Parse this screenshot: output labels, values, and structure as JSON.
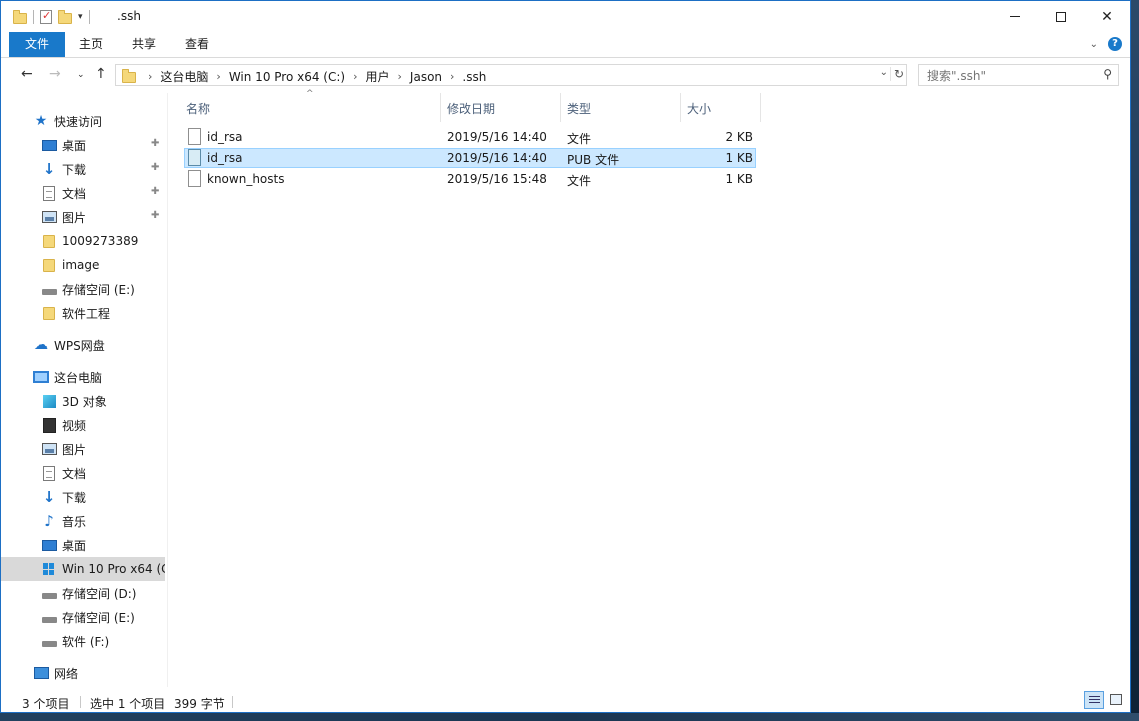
{
  "window": {
    "title": ".ssh"
  },
  "ribbon": {
    "tabs": [
      "文件",
      "主页",
      "共享",
      "查看"
    ]
  },
  "address": {
    "crumbs": [
      "这台电脑",
      "Win 10 Pro x64 (C:)",
      "用户",
      "Jason",
      ".ssh"
    ]
  },
  "search": {
    "placeholder": "搜索\".ssh\""
  },
  "nav": {
    "quick_access": "快速访问",
    "quick_items": [
      "桌面",
      "下载",
      "文档",
      "图片",
      "1009273389",
      "image",
      "存储空间 (E:)",
      "软件工程"
    ],
    "wps": "WPS网盘",
    "this_pc": "这台电脑",
    "pc_items": [
      "3D 对象",
      "视频",
      "图片",
      "文档",
      "下载",
      "音乐",
      "桌面",
      "Win 10 Pro x64 (C",
      "存储空间 (D:)",
      "存储空间 (E:)",
      "软件 (F:)"
    ],
    "network": "网络"
  },
  "columns": {
    "name": "名称",
    "modified": "修改日期",
    "type": "类型",
    "size": "大小"
  },
  "files": [
    {
      "name": "id_rsa",
      "modified": "2019/5/16 14:40",
      "type": "文件",
      "size": "2 KB"
    },
    {
      "name": "id_rsa",
      "modified": "2019/5/16 14:40",
      "type": "PUB 文件",
      "size": "1 KB"
    },
    {
      "name": "known_hosts",
      "modified": "2019/5/16 15:48",
      "type": "文件",
      "size": "1 KB"
    }
  ],
  "status": {
    "count": "3 个项目",
    "selected": "选中 1 个项目",
    "bytes": "399 字节"
  },
  "colors": {
    "accent": "#1979ca",
    "selection": "#cce8ff",
    "selection_border": "#99d1ff"
  }
}
